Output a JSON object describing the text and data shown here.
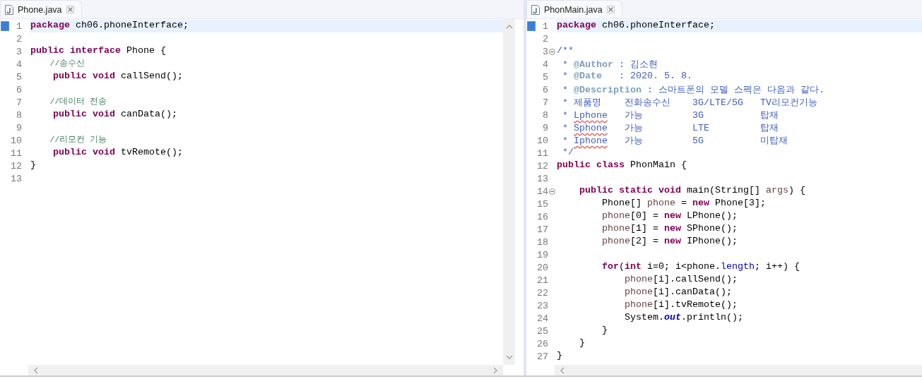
{
  "panes": [
    {
      "tab": {
        "title": "Phone.java"
      },
      "vertical_scrollbar": true,
      "lines": [
        {
          "number": "1",
          "current": true,
          "tokens": [
            {
              "text": "package",
              "kind": "keyword"
            },
            {
              "text": " ch06.phoneInterface;",
              "kind": "plain"
            }
          ]
        },
        {
          "number": "2",
          "current": false
        },
        {
          "number": "3",
          "current": false,
          "tokens": [
            {
              "text": "public interface",
              "kind": "keyword"
            },
            {
              "text": " Phone {",
              "kind": "plain"
            }
          ]
        },
        {
          "number": "4",
          "current": false,
          "tokens": [
            {
              "text": "    //송수신",
              "kind": "comment"
            }
          ]
        },
        {
          "number": "5",
          "current": false,
          "tokens": [
            {
              "text": "    public void",
              "kind": "keyword"
            },
            {
              "text": " callSend();",
              "kind": "plain"
            }
          ]
        },
        {
          "number": "6",
          "current": false
        },
        {
          "number": "7",
          "current": false,
          "tokens": [
            {
              "text": "    //데이터 전송",
              "kind": "comment"
            }
          ]
        },
        {
          "number": "8",
          "current": false,
          "tokens": [
            {
              "text": "    public void",
              "kind": "keyword"
            },
            {
              "text": " canData();",
              "kind": "plain"
            }
          ]
        },
        {
          "number": "9",
          "current": false
        },
        {
          "number": "10",
          "current": false,
          "tokens": [
            {
              "text": "    //리모컨 기능",
              "kind": "comment"
            }
          ]
        },
        {
          "number": "11",
          "current": false,
          "tokens": [
            {
              "text": "    public void",
              "kind": "keyword"
            },
            {
              "text": " tvRemote();",
              "kind": "plain"
            }
          ]
        },
        {
          "number": "12",
          "current": false,
          "tokens": [
            {
              "text": "}",
              "kind": "plain"
            }
          ]
        },
        {
          "number": "13",
          "current": false
        }
      ]
    },
    {
      "tab": {
        "title": "PhonMain.java"
      },
      "vertical_scrollbar": false,
      "lines": [
        {
          "number": "1",
          "current": true,
          "tokens": [
            {
              "text": "package",
              "kind": "keyword"
            },
            {
              "text": " ch06.phoneInterface;",
              "kind": "plain"
            }
          ]
        },
        {
          "number": "2",
          "current": false
        },
        {
          "number": "3",
          "current": false,
          "fold": true,
          "tokens": [
            {
              "text": "/**",
              "kind": "doc"
            }
          ]
        },
        {
          "number": "4",
          "current": false,
          "tokens": [
            {
              "text": " * ",
              "kind": "doc"
            },
            {
              "text": "@Author",
              "kind": "doc-tag"
            },
            {
              "text": " : 김소현",
              "kind": "doc"
            }
          ]
        },
        {
          "number": "5",
          "current": false,
          "tokens": [
            {
              "text": " * ",
              "kind": "doc"
            },
            {
              "text": "@Date",
              "kind": "doc-tag"
            },
            {
              "text": "   : 2020. 5. 8.",
              "kind": "doc"
            }
          ]
        },
        {
          "number": "6",
          "current": false,
          "tokens": [
            {
              "text": " * ",
              "kind": "doc"
            },
            {
              "text": "@Description",
              "kind": "doc-tag"
            },
            {
              "text": " : 스마트폰의 모델 스펙은 다음과 같다.",
              "kind": "doc"
            }
          ]
        },
        {
          "number": "7",
          "current": false,
          "prefix": " * ",
          "cells": [
            {
              "text": "제품명",
              "kind": "doc"
            },
            {
              "text": "전화송수신",
              "kind": "doc"
            },
            {
              "text": "3G/LTE/5G",
              "kind": "doc"
            },
            {
              "text": "TV리모컨기능",
              "kind": "doc"
            }
          ]
        },
        {
          "number": "8",
          "current": false,
          "prefix": " * ",
          "cells": [
            {
              "text": "Lphone",
              "kind": "misspelled"
            },
            {
              "text": "가능",
              "kind": "doc"
            },
            {
              "text": "3G",
              "kind": "doc"
            },
            {
              "text": "탑재",
              "kind": "doc"
            }
          ]
        },
        {
          "number": "9",
          "current": false,
          "prefix": " * ",
          "cells": [
            {
              "text": "Sphone",
              "kind": "misspelled"
            },
            {
              "text": "가능",
              "kind": "doc"
            },
            {
              "text": "LTE",
              "kind": "doc"
            },
            {
              "text": "탑재",
              "kind": "doc"
            }
          ]
        },
        {
          "number": "10",
          "current": false,
          "prefix": " * ",
          "cells": [
            {
              "text": "Iphone",
              "kind": "misspelled"
            },
            {
              "text": "가능",
              "kind": "doc"
            },
            {
              "text": "5G",
              "kind": "doc"
            },
            {
              "text": "미탑재",
              "kind": "doc"
            }
          ]
        },
        {
          "number": "11",
          "current": false,
          "tokens": [
            {
              "text": " */",
              "kind": "doc"
            }
          ]
        },
        {
          "number": "12",
          "current": false,
          "tokens": [
            {
              "text": "public class",
              "kind": "keyword"
            },
            {
              "text": " PhonMain {",
              "kind": "plain"
            }
          ]
        },
        {
          "number": "13",
          "current": false
        },
        {
          "number": "14",
          "current": false,
          "fold": true,
          "tokens": [
            {
              "text": "    public static void",
              "kind": "keyword"
            },
            {
              "text": " main(String[] ",
              "kind": "plain"
            },
            {
              "text": "args",
              "kind": "variable"
            },
            {
              "text": ") {",
              "kind": "plain"
            }
          ]
        },
        {
          "number": "15",
          "current": false,
          "tokens": [
            {
              "text": "        Phone[] ",
              "kind": "plain"
            },
            {
              "text": "phone",
              "kind": "variable"
            },
            {
              "text": " = ",
              "kind": "plain"
            },
            {
              "text": "new",
              "kind": "keyword"
            },
            {
              "text": " Phone[3];",
              "kind": "plain"
            }
          ]
        },
        {
          "number": "16",
          "current": false,
          "tokens": [
            {
              "text": "        phone",
              "kind": "variable"
            },
            {
              "text": "[0] = ",
              "kind": "plain"
            },
            {
              "text": "new",
              "kind": "keyword"
            },
            {
              "text": " LPhone();",
              "kind": "plain"
            }
          ]
        },
        {
          "number": "17",
          "current": false,
          "tokens": [
            {
              "text": "        phone",
              "kind": "variable"
            },
            {
              "text": "[1] = ",
              "kind": "plain"
            },
            {
              "text": "new",
              "kind": "keyword"
            },
            {
              "text": " SPhone();",
              "kind": "plain"
            }
          ]
        },
        {
          "number": "18",
          "current": false,
          "tokens": [
            {
              "text": "        phone",
              "kind": "variable"
            },
            {
              "text": "[2] = ",
              "kind": "plain"
            },
            {
              "text": "new",
              "kind": "keyword"
            },
            {
              "text": " IPhone();",
              "kind": "plain"
            }
          ]
        },
        {
          "number": "19",
          "current": false
        },
        {
          "number": "20",
          "current": false,
          "tokens": [
            {
              "text": "        for",
              "kind": "keyword"
            },
            {
              "text": "(",
              "kind": "plain"
            },
            {
              "text": "int",
              "kind": "keyword"
            },
            {
              "text": " i=0; i<phone.",
              "kind": "plain"
            },
            {
              "text": "length",
              "kind": "field"
            },
            {
              "text": "; i++) {",
              "kind": "plain"
            }
          ]
        },
        {
          "number": "21",
          "current": false,
          "tokens": [
            {
              "text": "            phone",
              "kind": "variable"
            },
            {
              "text": "[i].callSend();",
              "kind": "plain"
            }
          ]
        },
        {
          "number": "22",
          "current": false,
          "tokens": [
            {
              "text": "            phone",
              "kind": "variable"
            },
            {
              "text": "[i].canData();",
              "kind": "plain"
            }
          ]
        },
        {
          "number": "23",
          "current": false,
          "tokens": [
            {
              "text": "            phone",
              "kind": "variable"
            },
            {
              "text": "[i].tvRemote();",
              "kind": "plain"
            }
          ]
        },
        {
          "number": "24",
          "current": false,
          "tokens": [
            {
              "text": "            System.",
              "kind": "plain"
            },
            {
              "text": "out",
              "kind": "static-field"
            },
            {
              "text": ".println();",
              "kind": "plain"
            }
          ]
        },
        {
          "number": "25",
          "current": false,
          "tokens": [
            {
              "text": "        }",
              "kind": "plain"
            }
          ]
        },
        {
          "number": "26",
          "current": false,
          "tokens": [
            {
              "text": "    }",
              "kind": "plain"
            }
          ]
        },
        {
          "number": "27",
          "current": false,
          "tokens": [
            {
              "text": "}",
              "kind": "plain"
            }
          ]
        }
      ]
    }
  ]
}
